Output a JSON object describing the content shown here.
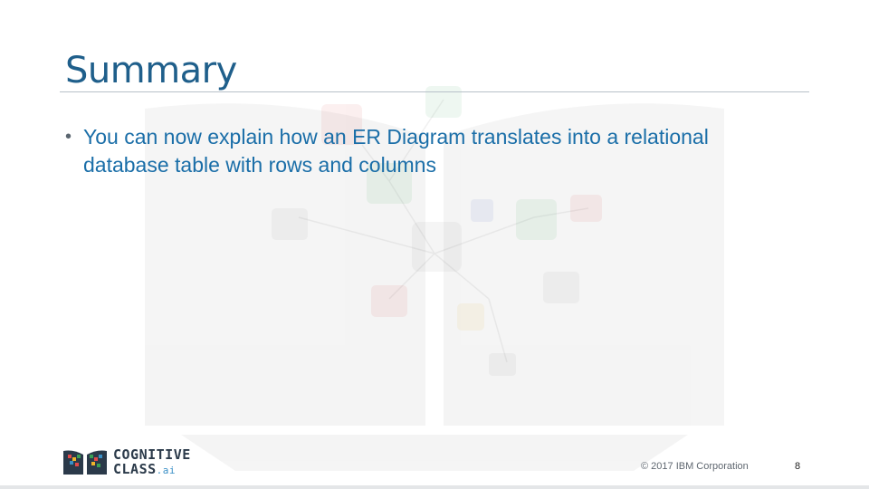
{
  "slide": {
    "title": "Summary",
    "bullets": [
      "You can now explain how an ER Diagram translates into a relational database table with rows and columns"
    ],
    "bullet_glyph": "•"
  },
  "footer": {
    "logo": {
      "line1": "COGNITIVE",
      "line2": "CLASS",
      "suffix": ".ai"
    },
    "copyright": "© 2017 IBM Corporation",
    "page_number": "8"
  },
  "colors": {
    "title": "#1f5f8b",
    "body_text": "#1a6ea8",
    "rule": "#b7c0c8"
  }
}
